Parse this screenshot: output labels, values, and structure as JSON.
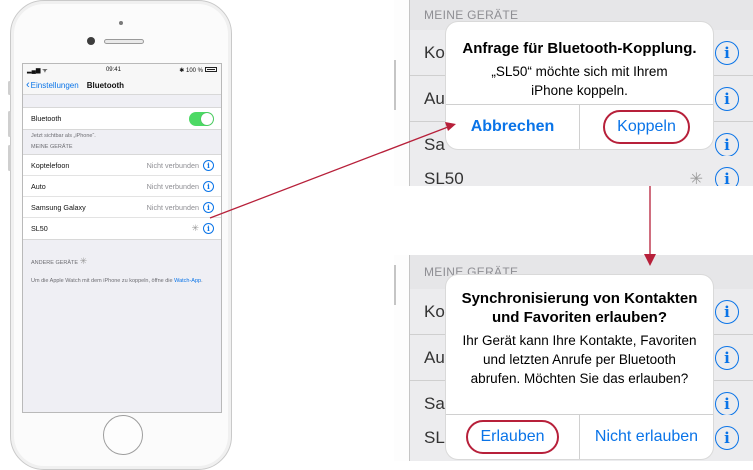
{
  "phone": {
    "status": {
      "time": "09:41",
      "battery": "100 %",
      "carrier": "▂▄▆",
      "wifi": "ᯤ",
      "bt": "✱"
    },
    "nav": {
      "back_label": "Einstellungen",
      "title": "Bluetooth"
    },
    "bluetooth": {
      "label": "Bluetooth",
      "on": true
    },
    "visible_note": "Jetzt sichtbar als „iPhone“.",
    "my_devices_header": "MEINE GERÄTE",
    "devices": [
      {
        "name": "Koptelefoon",
        "status": "Nicht verbunden"
      },
      {
        "name": "Auto",
        "status": "Nicht verbunden"
      },
      {
        "name": "Samsung Galaxy",
        "status": "Nicht verbunden"
      },
      {
        "name": "SL50",
        "status": ""
      }
    ],
    "other_devices_header": "ANDERE GERÄTE",
    "footer_text": "Um die Apple Watch mit dem iPhone zu koppeln, öffne die ",
    "footer_link": "Watch-App",
    "footer_end": "."
  },
  "panel1": {
    "section_header": "MEINE GERÄTE",
    "rows": [
      "Ko",
      "Au",
      "Sa",
      "SL50"
    ],
    "alert": {
      "title": "Anfrage für Bluetooth-Kopplung.",
      "message_line1": "„SL50“ möchte sich mit Ihrem",
      "message_line2": "iPhone koppeln.",
      "cancel_label": "Abbrechen",
      "confirm_label": "Koppeln"
    }
  },
  "panel2": {
    "section_header": "MEINE GERÄTE",
    "rows": [
      "Ko",
      "Au",
      "Sa",
      "SL"
    ],
    "alert": {
      "title_line1": "Synchronisierung von Kontakten",
      "title_line2": "und Favoriten erlauben?",
      "message_line1": "Ihr Gerät kann Ihre Kontakte, Favoriten",
      "message_line2": "und letzten Anrufe per Bluetooth",
      "message_line3": "abrufen. Möchten Sie das erlauben?",
      "allow_label": "Erlauben",
      "deny_label": "Nicht erlauben"
    }
  },
  "icons": {
    "info": "i",
    "spinner": "✳",
    "chevron": "‹"
  },
  "colors": {
    "accent": "#0a74e8",
    "toggle_on": "#4cd964",
    "highlight": "#b7203a"
  }
}
